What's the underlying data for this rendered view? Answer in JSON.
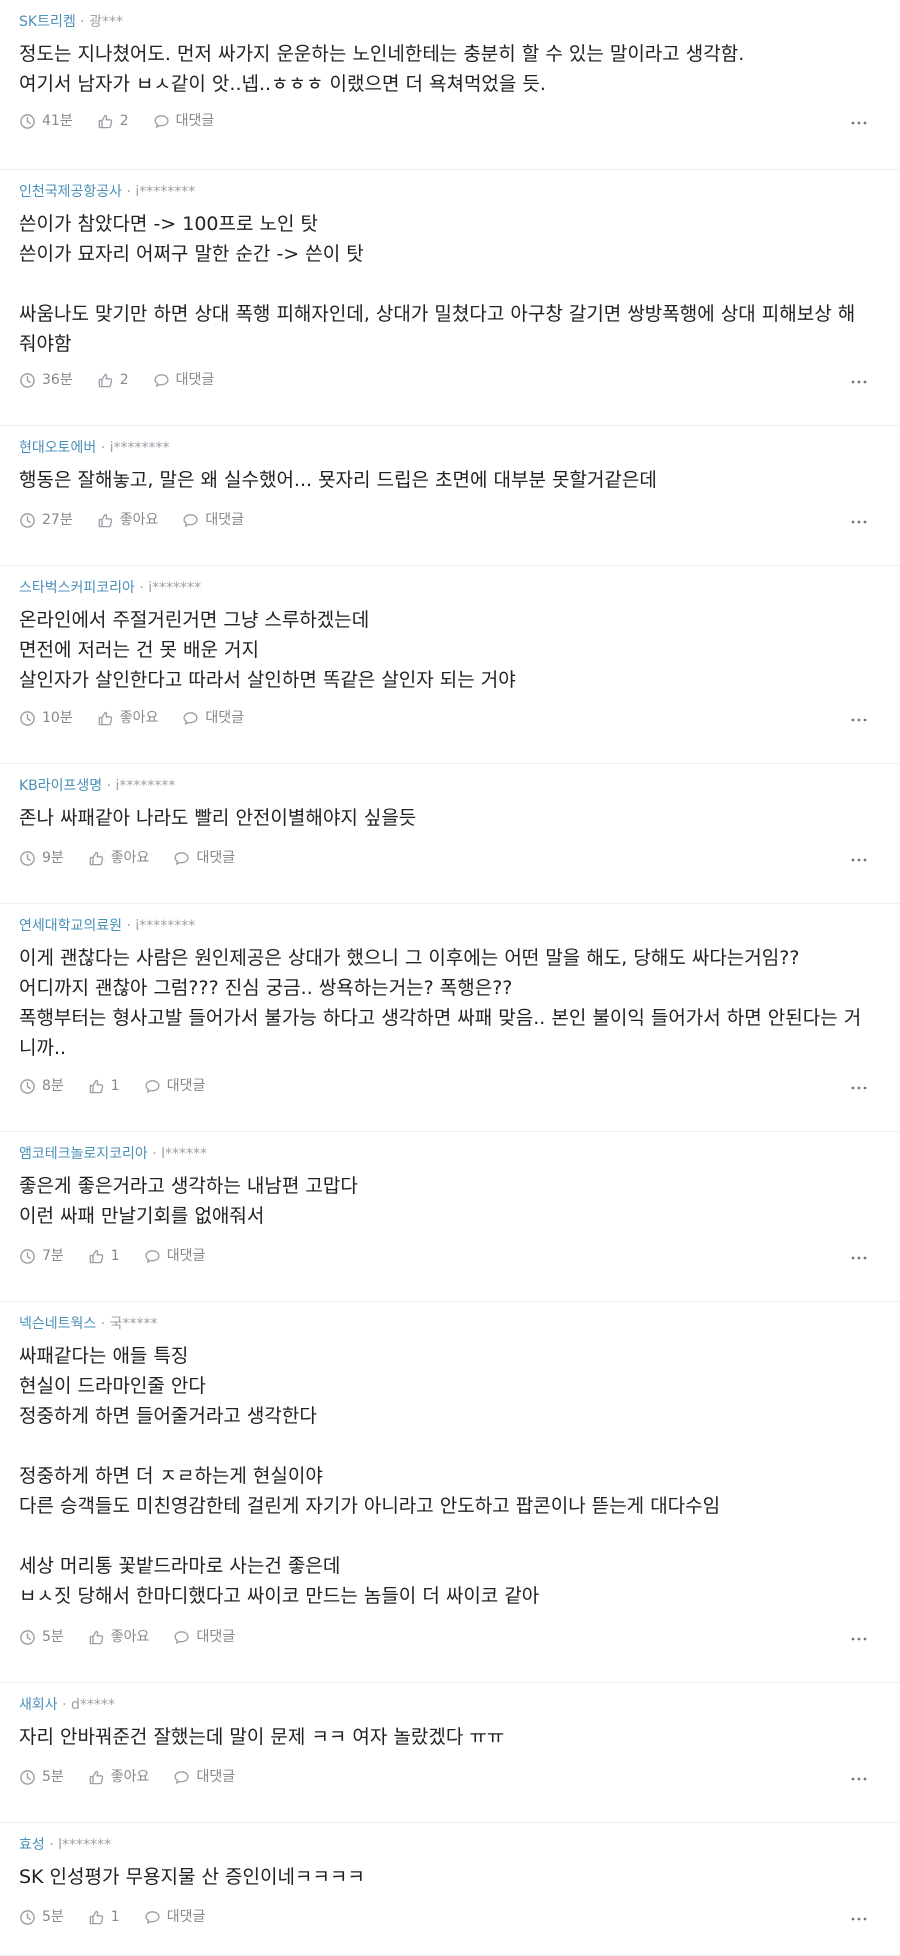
{
  "comments": [
    {
      "company": "SK트리켐",
      "user": "광***",
      "lines": [
        "정도는 지나쳤어도. 먼저 싸가지 운운하는 노인네한테는 충분히 할 수 있는 말이라고 생각함.",
        "여기서 남자가 ㅂㅅ같이 앗..넵..ㅎㅎㅎ 이랬으면 더 욕쳐먹었을 듯."
      ],
      "time": "41분",
      "likes": "2",
      "reply": "대댓글"
    },
    {
      "company": "인천국제공항공사",
      "user": "i********",
      "lines": [
        "쓴이가 참았다면 -> 100프로 노인 탓",
        "쓴이가 묘자리 어쩌구 말한 순간 -> 쓴이 탓",
        "",
        "싸움나도 맞기만 하면 상대 폭행 피해자인데, 상대가 밀쳤다고 아구창 갈기면 쌍방폭행에 상대 피해보상 해",
        "줘야함"
      ],
      "time": "36분",
      "likes": "2",
      "reply": "대댓글"
    },
    {
      "company": "현대오토에버",
      "user": "i********",
      "lines": [
        "행동은 잘해놓고, 말은 왜 실수했어... 묫자리 드립은 초면에 대부분 못할거같은데"
      ],
      "time": "27분",
      "likes": "좋아요",
      "reply": "대댓글"
    },
    {
      "company": "스타벅스커피코리아",
      "user": "i*******",
      "lines": [
        "온라인에서 주절거린거면 그냥 스루하겠는데",
        "면전에 저러는 건 못 배운 거지",
        "살인자가 살인한다고 따라서 살인하면 똑같은 살인자 되는 거야"
      ],
      "time": "10분",
      "likes": "좋아요",
      "reply": "대댓글"
    },
    {
      "company": "KB라이프생명",
      "user": "i********",
      "lines": [
        "존나 싸패같아 나라도 빨리 안전이별해야지 싶을듯"
      ],
      "time": "9분",
      "likes": "좋아요",
      "reply": "대댓글"
    },
    {
      "company": "연세대학교의료원",
      "user": "i********",
      "lines": [
        "이게 괜찮다는 사람은 원인제공은 상대가 했으니 그 이후에는 어떤 말을 해도, 당해도 싸다는거임??",
        "어디까지 괜찮아 그럼??? 진심 궁금.. 쌍욕하는거는? 폭행은??",
        "폭행부터는 형사고발 들어가서 불가능 하다고 생각하면 싸패 맞음.. 본인 불이익 들어가서 하면 안된다는 거",
        "니까.."
      ],
      "time": "8분",
      "likes": "1",
      "reply": "대댓글"
    },
    {
      "company": "앰코테크놀로지코리아",
      "user": "l******",
      "lines": [
        "좋은게 좋은거라고 생각하는 내남편 고맙다",
        "이런 싸패 만날기회를 없애줘서"
      ],
      "time": "7분",
      "likes": "1",
      "reply": "대댓글"
    },
    {
      "company": "넥슨네트웍스",
      "user": "국*****",
      "lines": [
        "싸패같다는 애들 특징",
        "현실이 드라마인줄 안다",
        "정중하게 하면 들어줄거라고 생각한다",
        "",
        "정중하게 하면 더 ㅈㄹ하는게 현실이야",
        "다른 승객들도 미친영감한테 걸린게 자기가 아니라고 안도하고 팝콘이나 뜯는게 대다수임",
        "",
        "세상 머리통 꽃밭드라마로 사는건 좋은데",
        "ㅂㅅ짓 당해서 한마디했다고 싸이코 만드는 놈들이 더 싸이코 같아"
      ],
      "time": "5분",
      "likes": "좋아요",
      "reply": "대댓글"
    },
    {
      "company": "새회사",
      "user": "d*****",
      "lines": [
        "자리 안바꿔준건 잘했는데 말이 문제 ㅋㅋ 여자 놀랐겠다 ㅠㅠ"
      ],
      "time": "5분",
      "likes": "좋아요",
      "reply": "대댓글"
    },
    {
      "company": "효성",
      "user": "l*******",
      "lines": [
        "SK 인성평가 무용지물 산 증인이네ㅋㅋㅋㅋ"
      ],
      "time": "5분",
      "likes": "1",
      "reply": "대댓글"
    }
  ]
}
